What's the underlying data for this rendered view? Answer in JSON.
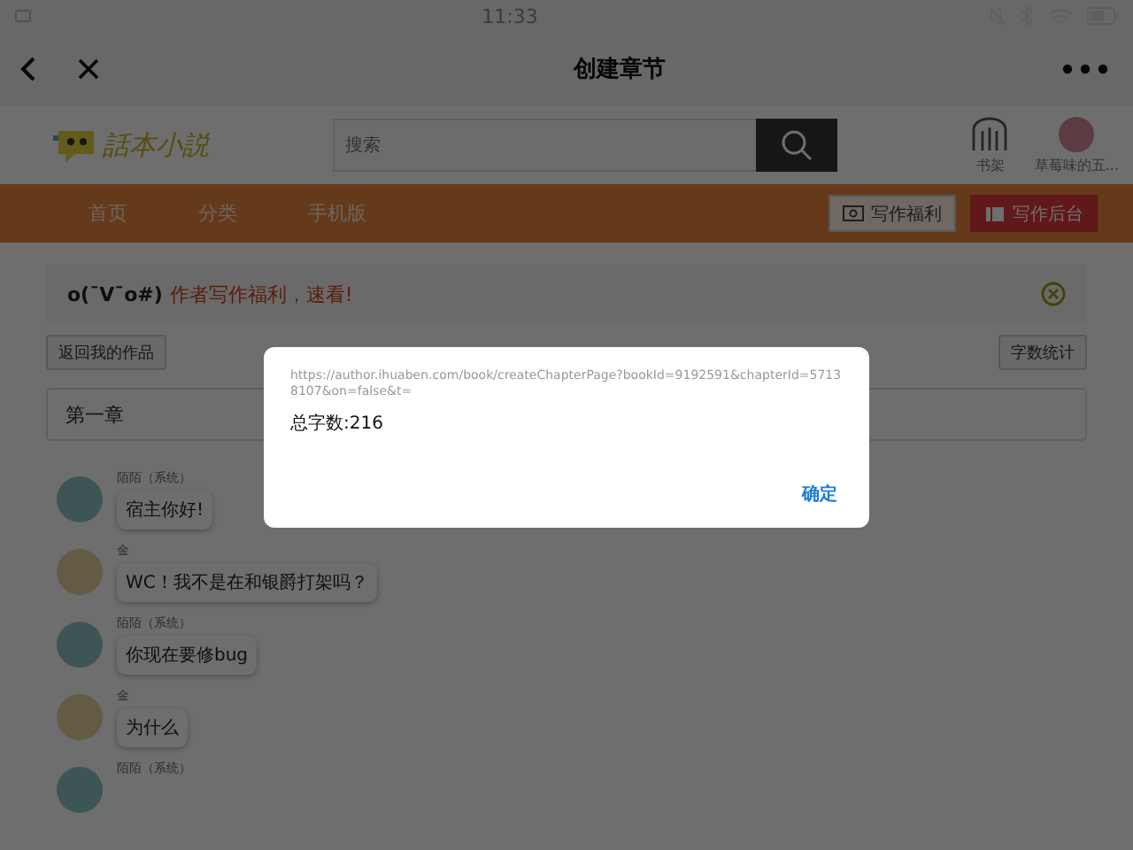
{
  "status_bar": {
    "time": "11:33"
  },
  "title_bar": {
    "title": "创建章节"
  },
  "site_header": {
    "logo": "話本小説",
    "search": {
      "placeholder": "搜索"
    },
    "bookshelf": "书架",
    "user": "草莓味的五..."
  },
  "nav": {
    "items": [
      {
        "label": "首页"
      },
      {
        "label": "分类"
      },
      {
        "label": "手机版"
      }
    ],
    "buttons": [
      {
        "kind": "welfare",
        "label": "写作福利"
      },
      {
        "kind": "backend",
        "label": "写作后台"
      }
    ]
  },
  "notice": {
    "emoticon": "o(¯V¯o#)",
    "text": "作者写作福利，速看!"
  },
  "toolbar": {
    "back": "返回我的作品",
    "count": "字数统计"
  },
  "chapter_title": {
    "value": "第一章"
  },
  "messages": [
    {
      "kind": "system",
      "name": "陌陌（系统）",
      "text": "宿主你好!"
    },
    {
      "kind": "user",
      "name": "金",
      "text": "WC！我不是在和银爵打架吗？"
    },
    {
      "kind": "system",
      "name": "陌陌（系统）",
      "text": "你现在要修bug"
    },
    {
      "kind": "user",
      "name": "金",
      "text": "为什么"
    },
    {
      "kind": "system",
      "name": "陌陌（系统）"
    }
  ],
  "dialog": {
    "url": "https://author.ihuaben.com/book/createChapterPage?bookId=9192591&chapterId=57138107&on=false&t=",
    "message": "总字数:216",
    "button": "确定"
  }
}
